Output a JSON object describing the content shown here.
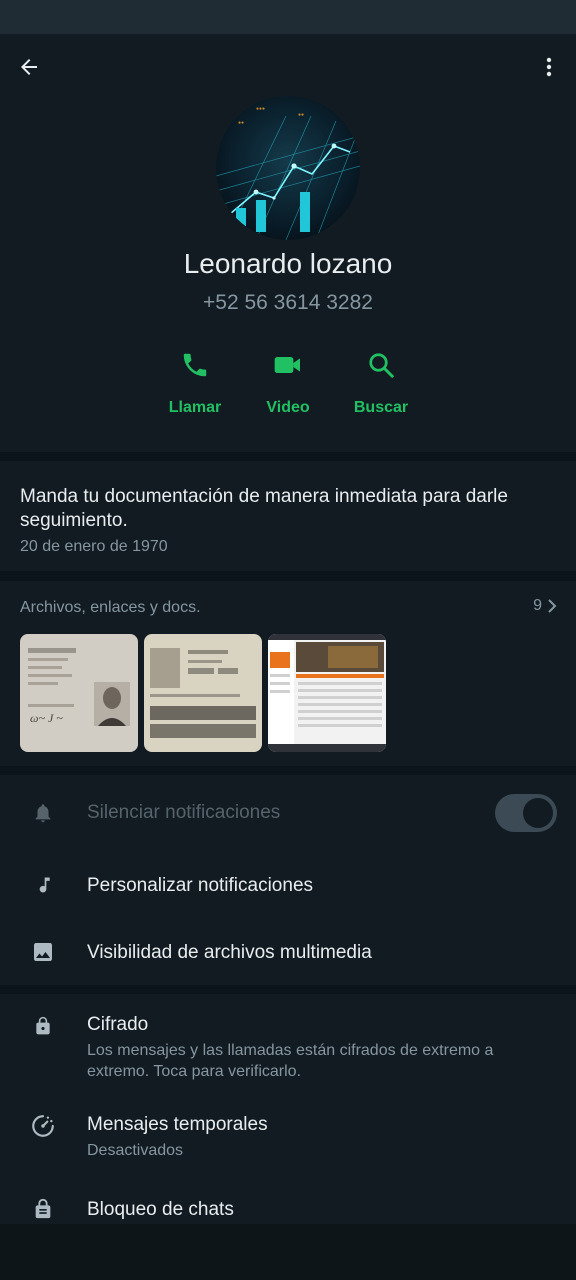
{
  "contact": {
    "name": "Leonardo lozano",
    "phone": "+52 56 3614 3282"
  },
  "actions": {
    "call": "Llamar",
    "video": "Video",
    "search": "Buscar"
  },
  "about": {
    "text": "Manda tu documentación de manera inmediata para darle seguimiento.",
    "date": "20 de enero de 1970"
  },
  "media": {
    "title": "Archivos, enlaces y docs.",
    "count": "9"
  },
  "settings": {
    "mute": "Silenciar notificaciones",
    "custom_notifications": "Personalizar notificaciones",
    "media_visibility": "Visibilidad de archivos multimedia",
    "encryption_title": "Cifrado",
    "encryption_desc": "Los mensajes y las llamadas están cifrados de extremo a extremo. Toca para verificarlo.",
    "disappearing_title": "Mensajes temporales",
    "disappearing_status": "Desactivados",
    "chat_lock": "Bloqueo de chats"
  },
  "colors": {
    "accent": "#21c063",
    "background": "#0b141a",
    "surface": "#111b21",
    "secondary_text": "#8696a0"
  },
  "icons": [
    "back-arrow-icon",
    "more-vert-icon",
    "phone-icon",
    "video-camera-icon",
    "search-icon",
    "bell-icon",
    "music-note-icon",
    "image-icon",
    "lock-icon",
    "timer-icon",
    "chat-lock-icon",
    "chevron-right-icon"
  ]
}
